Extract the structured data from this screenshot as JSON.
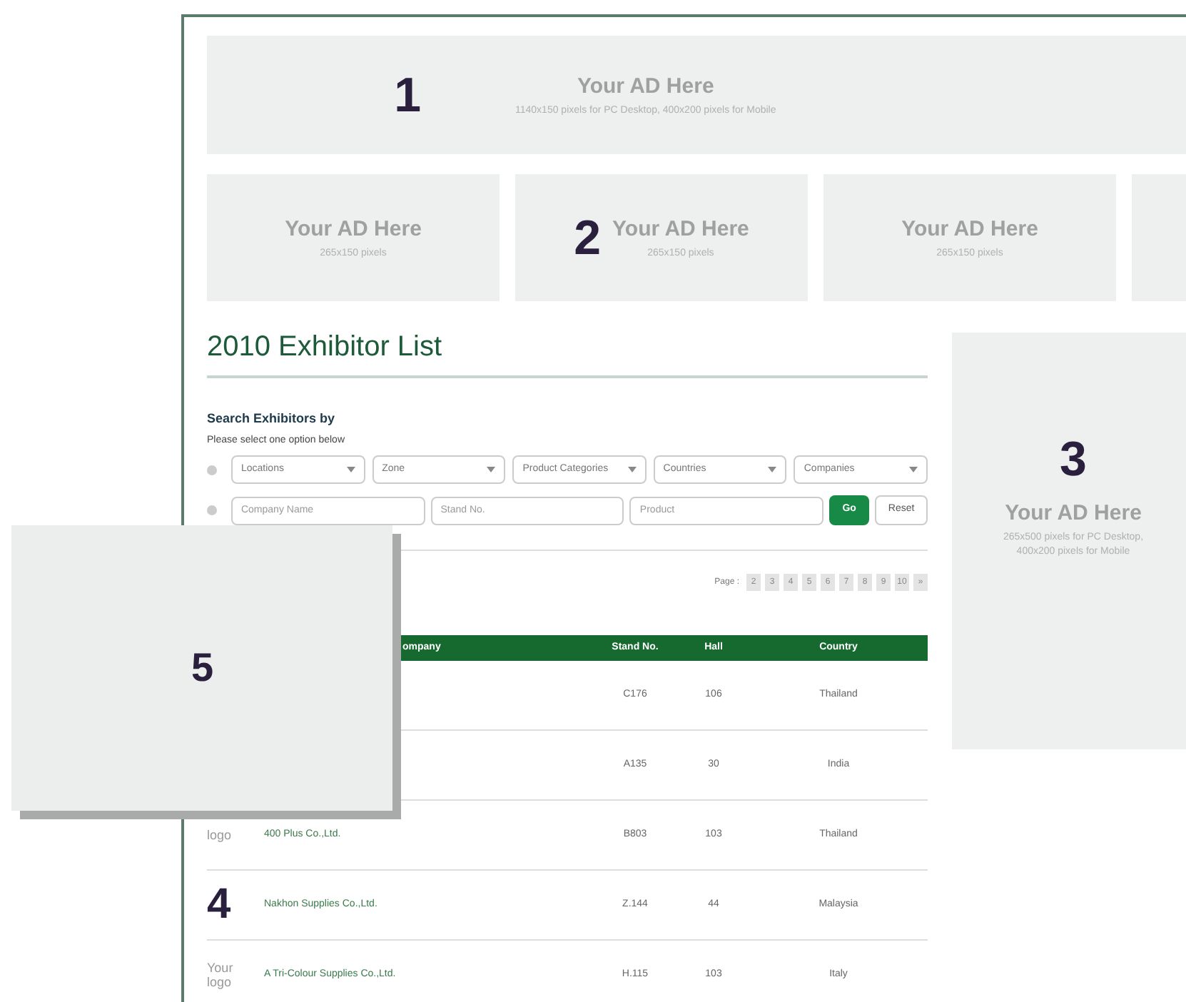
{
  "top_ad": {
    "number": "1",
    "title": "Your AD Here",
    "subtitle": "1140x150 pixels for PC Desktop, 400x200 pixels for Mobile"
  },
  "ad_row": [
    {
      "title": "Your AD Here",
      "subtitle": "265x150 pixels"
    },
    {
      "number": "2",
      "title": "Your AD Here",
      "subtitle": "265x150 pixels"
    },
    {
      "title": "Your AD Here",
      "subtitle": "265x150 pixels"
    }
  ],
  "heading": "2010 Exhibitor List",
  "search": {
    "title": "Search Exhibitors by",
    "hint": "Please select one option below",
    "options": [
      {
        "selected": false
      },
      {
        "selected": false
      }
    ],
    "selects": [
      "Locations",
      "Zone",
      "Product Categories",
      "Countries",
      "Companies"
    ],
    "fields": [
      {
        "placeholder": "Company Name"
      },
      {
        "placeholder": "Stand No."
      },
      {
        "placeholder": "Product"
      }
    ],
    "buttons": [
      {
        "label": "Go",
        "kind": "primary"
      },
      {
        "label": "Reset",
        "kind": "plain"
      }
    ]
  },
  "pagination": {
    "label": "Page :",
    "pages": [
      "2",
      "3",
      "4",
      "5",
      "6",
      "7",
      "8",
      "9",
      "10",
      "»"
    ]
  },
  "table": {
    "columns": [
      "ompany",
      "Stand No.",
      "Hall",
      "Country"
    ],
    "rows": [
      {
        "stand": "C176",
        "hall": "106",
        "country": "Thailand"
      },
      {
        "stand": "A135",
        "hall": "30",
        "country": "India"
      },
      {
        "logo": "logo",
        "name": "400 Plus Co.,Ltd.",
        "stand": "B803",
        "hall": "103",
        "country": "Thailand"
      },
      {
        "marker": "4",
        "name": "Nakhon Supplies Co.,Ltd.",
        "stand": "Z.144",
        "hall": "44",
        "country": "Malaysia"
      },
      {
        "logo": "Your logo",
        "name": "A Tri-Colour Supplies Co.,Ltd.",
        "stand": "H.115",
        "hall": "103",
        "country": "Italy"
      }
    ]
  },
  "side_ad": {
    "number": "3",
    "title": "Your AD Here",
    "lines": [
      "265x500 pixels for PC Desktop,",
      "400x200 pixels for Mobile"
    ]
  },
  "overlay_ad": {
    "number": "5"
  }
}
